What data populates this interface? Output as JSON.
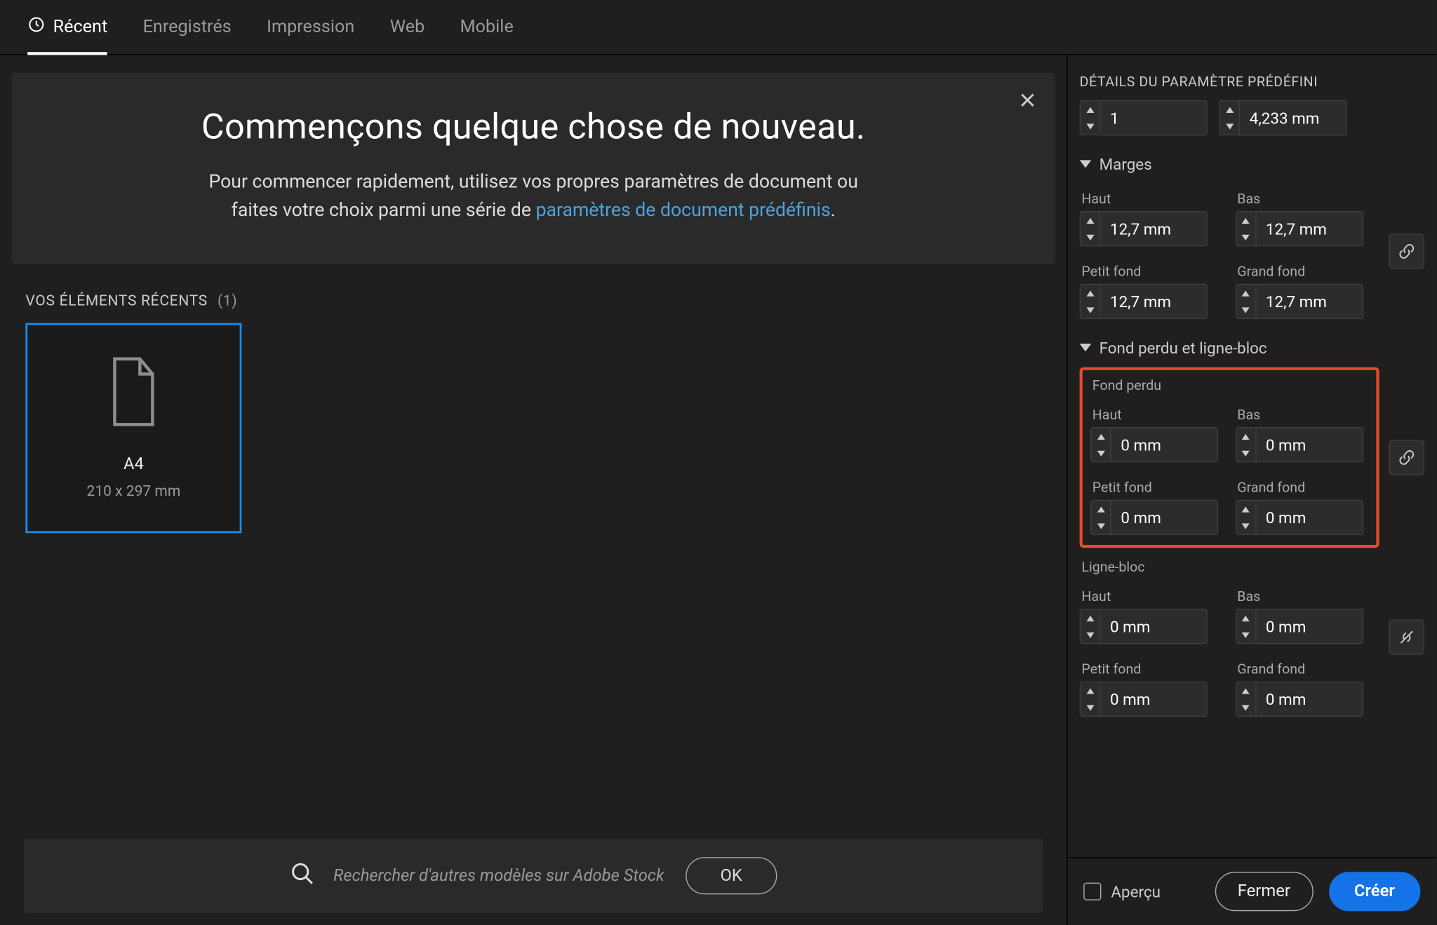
{
  "tabs": {
    "recent": "Récent",
    "saved": "Enregistrés",
    "print": "Impression",
    "web": "Web",
    "mobile": "Mobile"
  },
  "hero": {
    "title": "Commençons quelque chose de nouveau.",
    "sub1": "Pour commencer rapidement, utilisez vos propres paramètres de document ou",
    "sub2": "faites votre choix parmi une série de ",
    "link": "paramètres de document prédéfinis",
    "period": "."
  },
  "recent": {
    "header": "VOS ÉLÉMENTS RÉCENTS",
    "count": "(1)",
    "card": {
      "title": "A4",
      "dims": "210 x 297 mm"
    }
  },
  "search": {
    "placeholder": "Rechercher d'autres modèles sur Adobe Stock",
    "ok": "OK"
  },
  "preset": {
    "header": "DÉTAILS DU PARAMÈTRE PRÉDÉFINI",
    "facing_pages": "1",
    "bleed_value": "4,233 mm",
    "sections": {
      "marges": "Marges",
      "fond_perdu_ligne_bloc": "Fond perdu et ligne-bloc"
    },
    "labels": {
      "haut": "Haut",
      "bas": "Bas",
      "petit_fond": "Petit fond",
      "grand_fond": "Grand fond",
      "fond_perdu": "Fond perdu",
      "ligne_bloc": "Ligne-bloc"
    },
    "marges": {
      "haut": "12,7 mm",
      "bas": "12,7 mm",
      "petit_fond": "12,7 mm",
      "grand_fond": "12,7 mm"
    },
    "fond_perdu": {
      "haut": "0 mm",
      "bas": "0 mm",
      "petit_fond": "0 mm",
      "grand_fond": "0 mm"
    },
    "ligne_bloc": {
      "haut": "0 mm",
      "bas": "0 mm",
      "petit_fond": "0 mm",
      "grand_fond": "0 mm"
    }
  },
  "footer": {
    "apercu": "Aperçu",
    "fermer": "Fermer",
    "creer": "Créer"
  }
}
